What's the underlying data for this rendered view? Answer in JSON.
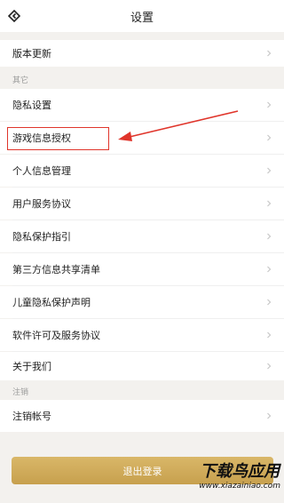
{
  "header": {
    "title": "设置"
  },
  "sections": [
    {
      "label": "",
      "items": [
        {
          "label": "版本更新"
        }
      ]
    },
    {
      "label": "其它",
      "items": [
        {
          "label": "隐私设置"
        },
        {
          "label": "游戏信息授权"
        },
        {
          "label": "个人信息管理"
        },
        {
          "label": "用户服务协议"
        },
        {
          "label": "隐私保护指引"
        },
        {
          "label": "第三方信息共享清单"
        },
        {
          "label": "儿童隐私保护声明"
        },
        {
          "label": "软件许可及服务协议"
        },
        {
          "label": "关于我们"
        }
      ]
    },
    {
      "label": "注销",
      "items": [
        {
          "label": "注销帐号"
        }
      ]
    }
  ],
  "footer": {
    "logout_label": "退出登录"
  },
  "watermark": {
    "brand": "下载鸟应用",
    "url": "www.xiazainiao.com"
  },
  "colors": {
    "accent": "#c9a24f",
    "annotation": "#e0352b",
    "background": "#f3f1ee"
  },
  "annotation": {
    "highlighted_item": "游戏信息授权"
  },
  "icons": {
    "back": "diamond-back-icon",
    "row_chevron": "chevron-right-icon"
  }
}
